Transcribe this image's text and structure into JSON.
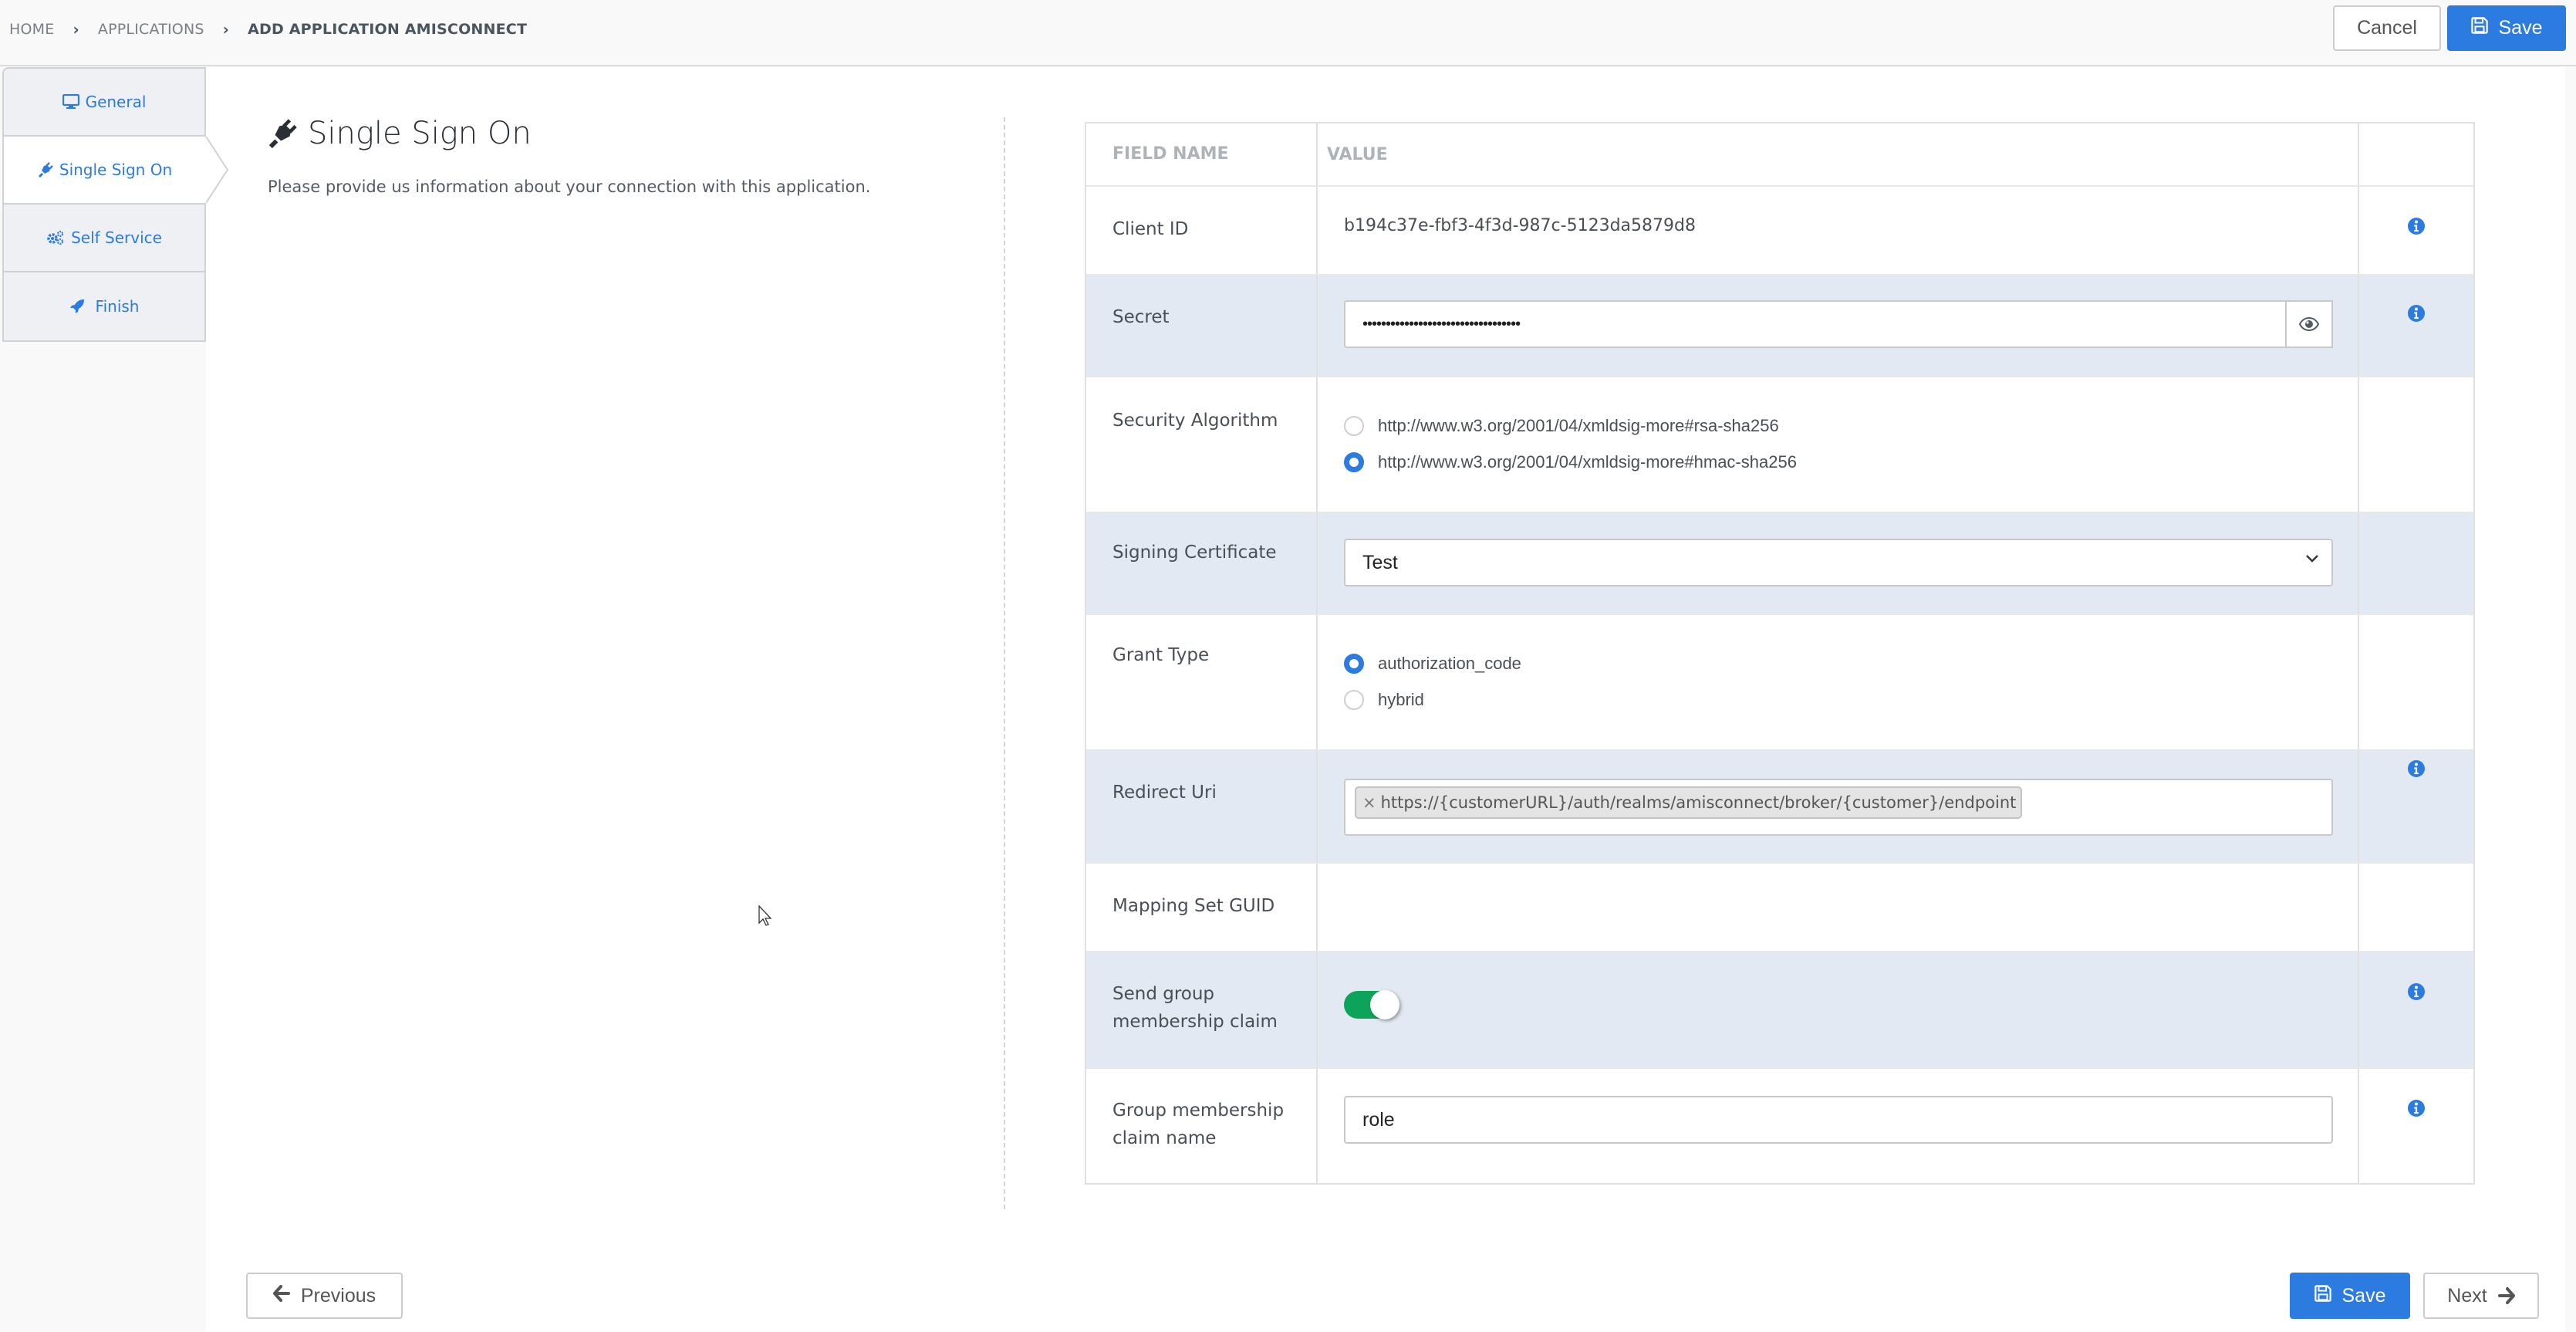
{
  "header": {
    "breadcrumb": [
      "HOME",
      "APPLICATIONS",
      "ADD APPLICATION AMISCONNECT"
    ],
    "cancel_label": "Cancel",
    "save_label": "Save"
  },
  "sidebar": {
    "tabs": [
      {
        "label": "General",
        "icon": "desktop-icon",
        "active": false
      },
      {
        "label": "Single Sign On",
        "icon": "plug-icon",
        "active": true
      },
      {
        "label": "Self Service",
        "icon": "cogs-icon",
        "active": false
      },
      {
        "label": "Finish",
        "icon": "rocket-icon",
        "active": false
      }
    ]
  },
  "page": {
    "title": "Single Sign On",
    "subtitle": "Please provide us information about your connection with this application."
  },
  "table": {
    "headers": [
      "FIELD NAME",
      "VALUE",
      ""
    ],
    "rows": {
      "client_id": {
        "label": "Client ID",
        "value": "b194c37e-fbf3-4f3d-987c-5123da5879d8",
        "info": true
      },
      "secret": {
        "label": "Secret",
        "value": "••••••••••••••••••••••••••••••••••",
        "info": true
      },
      "security_algorithm": {
        "label": "Security Algorithm",
        "options": [
          {
            "label": "http://www.w3.org/2001/04/xmldsig-more#rsa-sha256",
            "checked": false
          },
          {
            "label": "http://www.w3.org/2001/04/xmldsig-more#hmac-sha256",
            "checked": true
          }
        ]
      },
      "signing_certificate": {
        "label": "Signing Certificate",
        "selected": "Test"
      },
      "grant_type": {
        "label": "Grant Type",
        "options": [
          {
            "label": "authorization_code",
            "checked": true
          },
          {
            "label": "hybrid",
            "checked": false
          }
        ]
      },
      "redirect_uri": {
        "label": "Redirect Uri",
        "tags": [
          "https://{customerURL}/auth/realms/amisconnect/broker/{customer}/endpoint"
        ],
        "remove_glyph": "×",
        "info": true
      },
      "mapping_set_guid": {
        "label": "Mapping Set GUID",
        "value": ""
      },
      "send_group_claim": {
        "label_line1": "Send group",
        "label_line2": "membership claim",
        "enabled": true,
        "info": true
      },
      "group_claim_name": {
        "label_line1": "Group membership",
        "label_line2": "claim name",
        "value": "role",
        "info": true
      }
    }
  },
  "footer": {
    "previous_label": "Previous",
    "save_label": "Save",
    "next_label": "Next"
  },
  "colors": {
    "primary": "#2c7be0",
    "toggle_on": "#0ea35a",
    "row_shade": "#e2e9f2"
  }
}
